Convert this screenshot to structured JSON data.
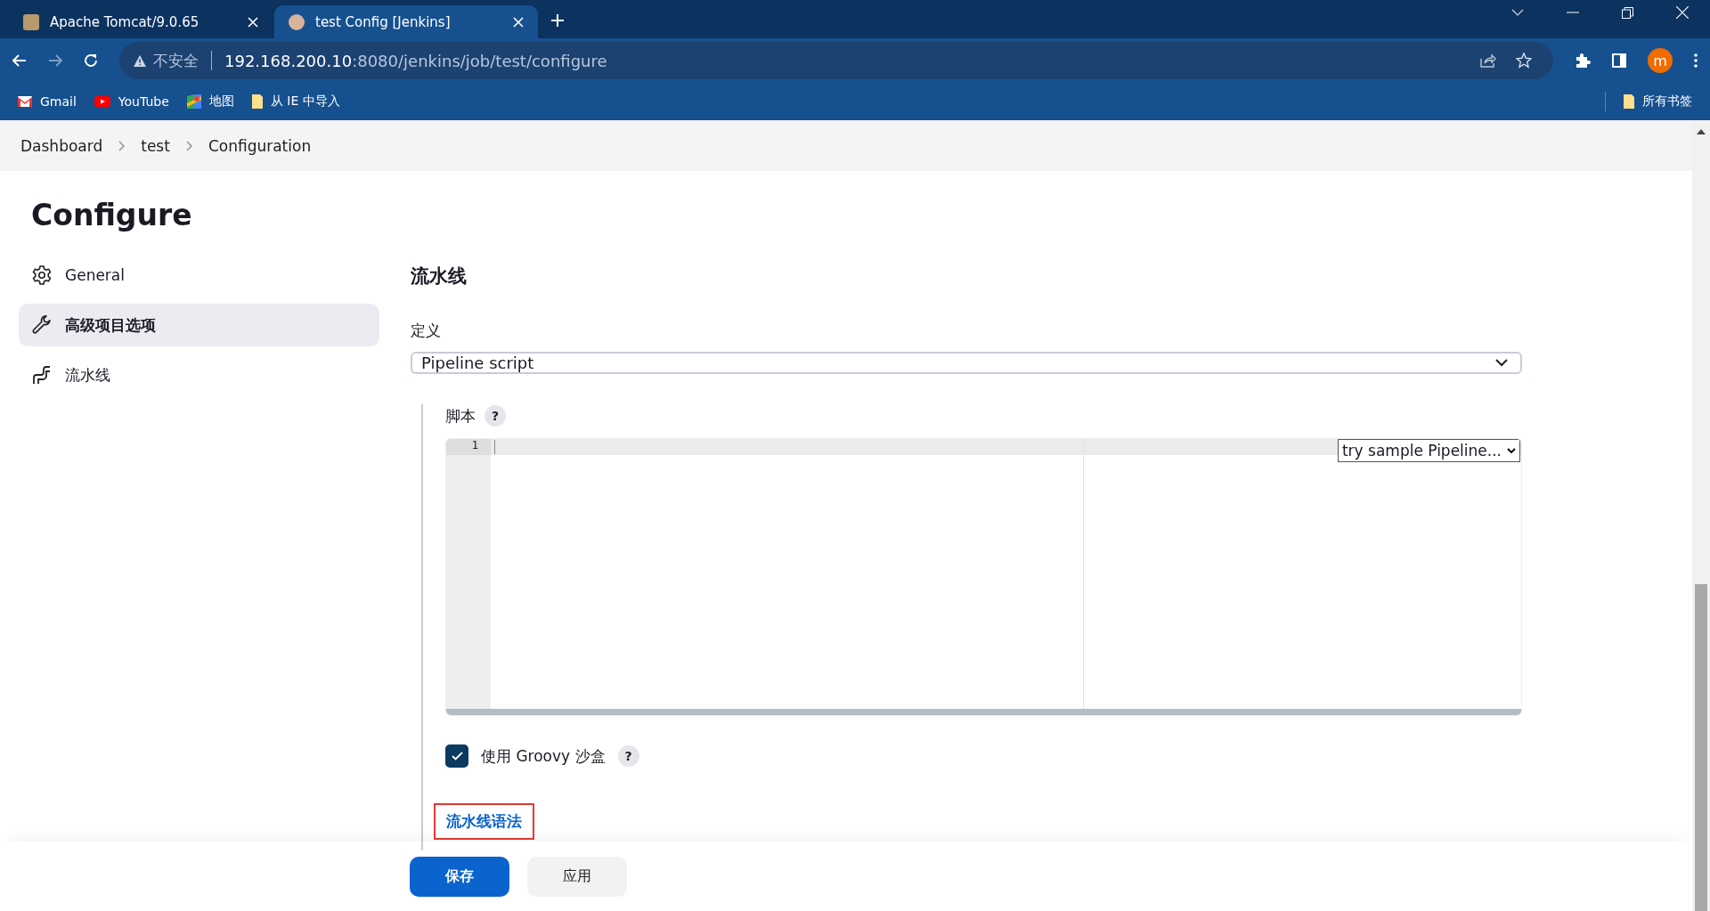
{
  "browser": {
    "tabs": [
      {
        "title": "Apache Tomcat/9.0.65",
        "selected": false
      },
      {
        "title": "test Config [Jenkins]",
        "selected": true
      }
    ],
    "address": {
      "warning": "不安全",
      "host": "192.168.200.10",
      "rest": ":8080/jenkins/job/test/configure"
    },
    "profile_initial": "m",
    "bookmarks": [
      {
        "label": "Gmail",
        "kind": "gmail"
      },
      {
        "label": "YouTube",
        "kind": "youtube"
      },
      {
        "label": "地图",
        "kind": "maps"
      },
      {
        "label": "从 IE 中导入",
        "kind": "folder"
      }
    ],
    "all_bookmarks": "所有书签"
  },
  "breadcrumb": [
    "Dashboard",
    "test",
    "Configuration"
  ],
  "sidebar": {
    "title": "Configure",
    "items": [
      {
        "label": "General",
        "kind": "gear",
        "selected": false
      },
      {
        "label": "高级项目选项",
        "kind": "wrench",
        "selected": true
      },
      {
        "label": "流水线",
        "kind": "pipeline",
        "selected": false
      }
    ]
  },
  "section": {
    "title": "流水线",
    "definition_label": "定义",
    "definition_value": "Pipeline script",
    "script_label": "脚本",
    "help": "?",
    "line_numbers": [
      "1"
    ],
    "sample_select": "try sample Pipeline...",
    "sandbox": {
      "label": "使用 Groovy 沙盒",
      "checked": true,
      "help": "?"
    },
    "syntax_link": {
      "label": "流水线语法",
      "annotated": true
    }
  },
  "buttons": [
    {
      "label": "保存",
      "kind": "primary"
    },
    {
      "label": "应用",
      "kind": "secondary"
    }
  ]
}
